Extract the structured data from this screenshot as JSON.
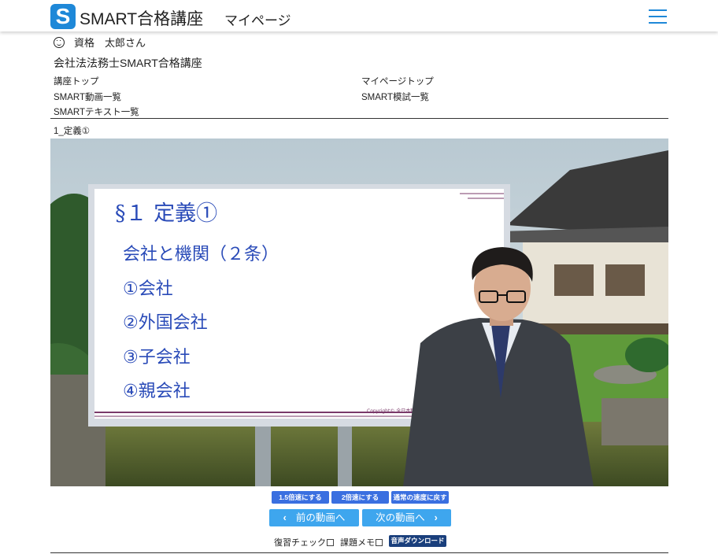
{
  "header": {
    "logo_letter": "S",
    "brand": "SMART合格講座",
    "subtitle": "マイページ"
  },
  "user": {
    "name": "資格　太郎さん"
  },
  "course_title": "会社法法務士SMART合格講座",
  "nav": {
    "course_top": "講座トップ",
    "mypage_top": "マイページトップ",
    "video_list": "SMART動画一覧",
    "exam_list": "SMART模試一覧",
    "text_list": "SMARTテキスト一覧"
  },
  "lesson_title": "1_定義①",
  "video": {
    "board_heading": "§１ 定義①",
    "board_lines": [
      "会社と機関（２条）",
      "①会社",
      "②外国会社",
      "③子会社",
      "④親会社"
    ],
    "copyright": "Copyright© 全日本職業学習"
  },
  "speed": {
    "x15": "1.5倍速にする",
    "x2": "2倍速にする",
    "normal": "通常の速度に戻す"
  },
  "pager": {
    "prev": "前の動画へ",
    "next": "次の動画へ"
  },
  "options": {
    "review_check": "復習チェック",
    "task_memo": "課題メモ",
    "audio_download": "音声ダウンロード"
  },
  "colors": {
    "accent": "#1e88d8",
    "speed_button": "#3a6fe0",
    "pager_button": "#3ea6ee",
    "download_button": "#1a3f7c",
    "board_text": "#2a4bb8"
  }
}
